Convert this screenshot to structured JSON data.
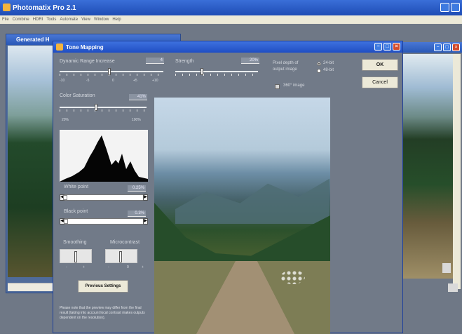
{
  "app": {
    "title": "Photomatix Pro 2.1"
  },
  "menu": [
    "File",
    "Combine",
    "HDRI",
    "Tools",
    "Automate",
    "View",
    "Window",
    "Help"
  ],
  "generated_window": {
    "title": "Generated H"
  },
  "tone_mapping": {
    "title": "Tone Mapping",
    "dynamic_range": {
      "label": "Dynamic Range Increase",
      "value": "4",
      "ticks": [
        "-10",
        "-5",
        "0",
        "+5",
        "+10"
      ],
      "level": 0.48
    },
    "strength": {
      "label": "Strength",
      "value": "20%",
      "level": 0.32
    },
    "pixel_depth": {
      "label_line1": "Pixel depth of",
      "label_line2": "output image",
      "option_24": "24-bit",
      "option_48": "48-bit"
    },
    "image_360": {
      "label": "360° image"
    },
    "color_saturation": {
      "label": "Color Saturation",
      "value": "41%",
      "ticks": [
        "20%",
        "100%"
      ],
      "level": 0.42
    },
    "white_point": {
      "label": "White point",
      "value": "0.25%",
      "level": 0.05
    },
    "black_point": {
      "label": "Black point",
      "value": "0.3%",
      "level": 0.06
    },
    "smoothing": {
      "label": "Smoothing",
      "ticks": [
        "-",
        "+"
      ]
    },
    "microcontrast": {
      "label": "Microcontrast",
      "ticks": [
        "-",
        "0",
        "+"
      ]
    },
    "buttons": {
      "ok": "OK",
      "cancel": "Cancel",
      "previous": "Previous Settings"
    },
    "note": "Please note that the preview may differ from the final result (taking into account local contrast makes outputs dependent on the resolution)."
  }
}
